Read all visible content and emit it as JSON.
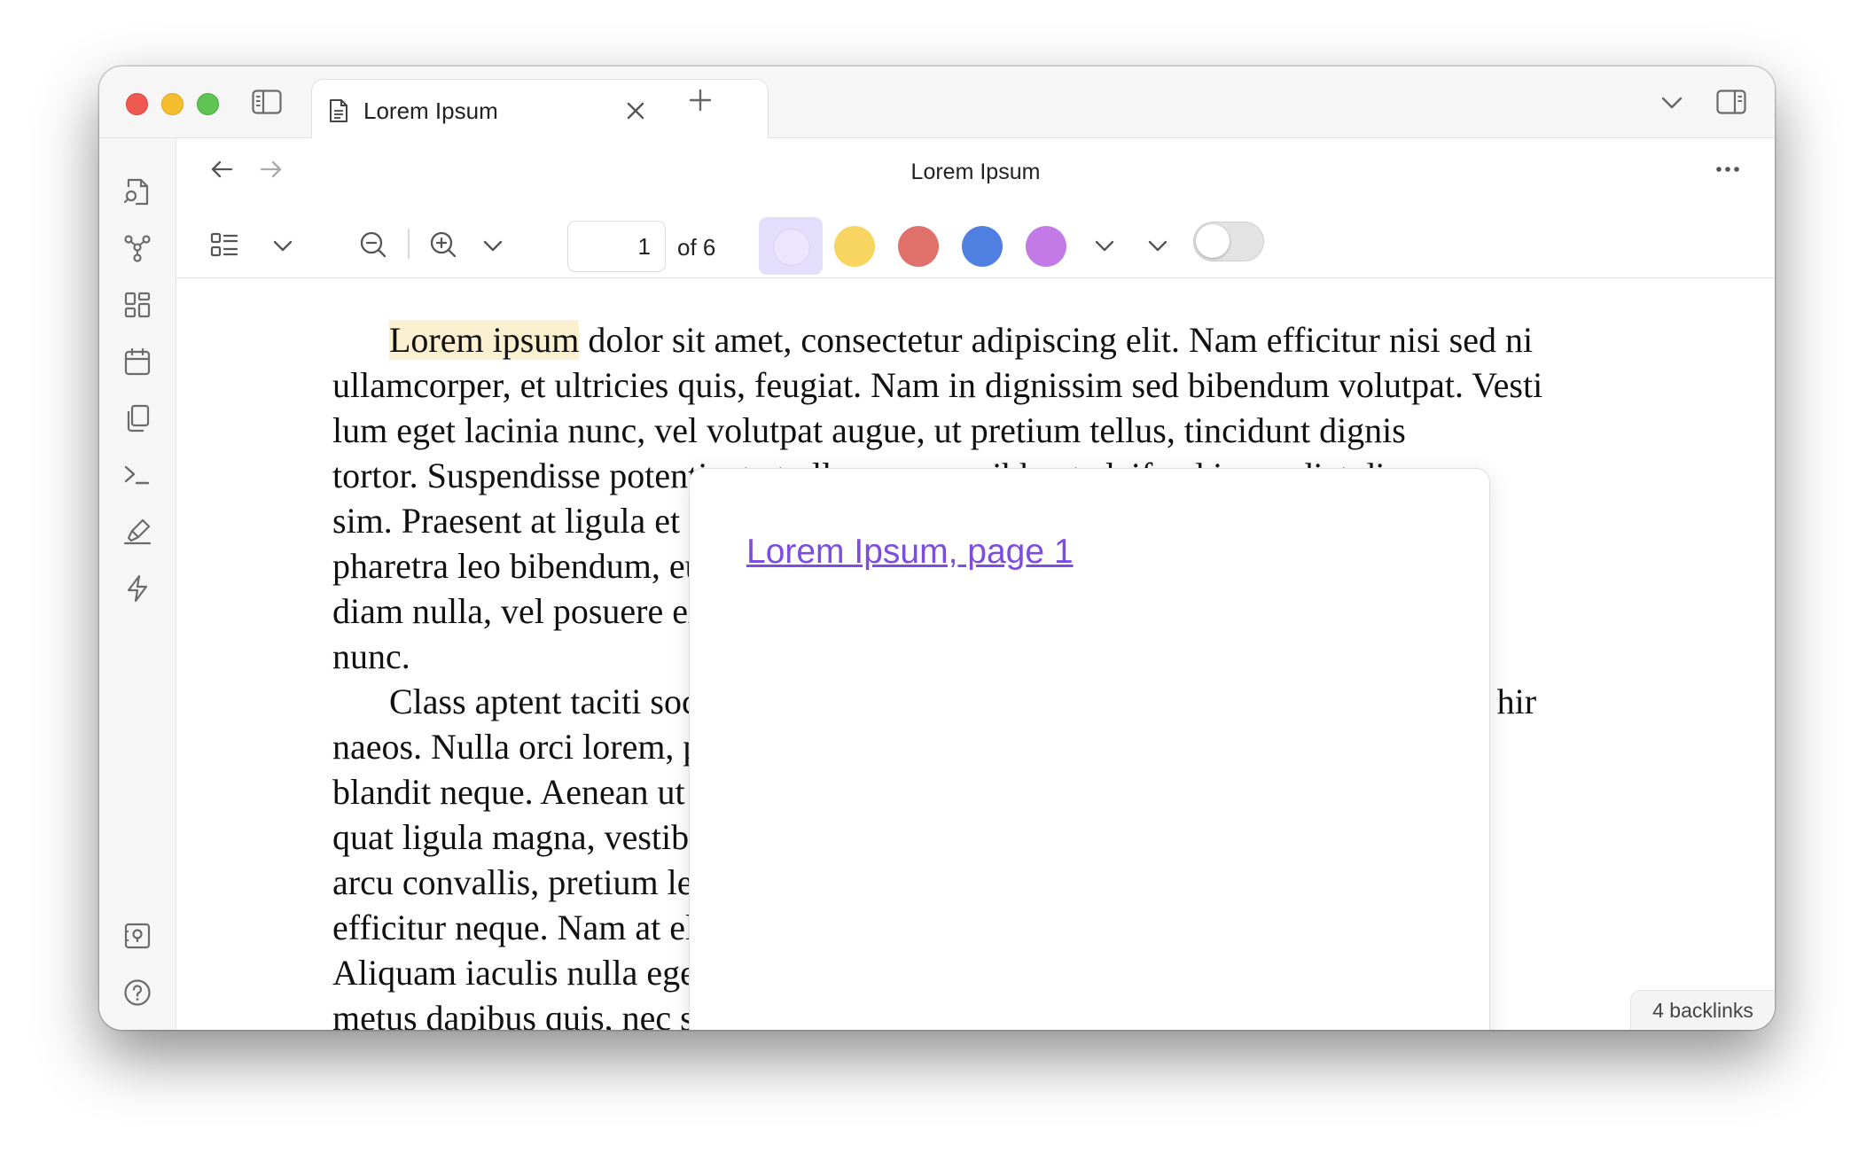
{
  "window": {
    "tab_title": "Lorem Ipsum",
    "icons": {
      "sidebar_toggle": "sidebar-left-icon",
      "tab_file": "file-icon",
      "tab_close": "close-icon",
      "new_tab": "plus-icon",
      "tab_list": "chevron-down-icon",
      "right_sidebar_toggle": "sidebar-right-icon"
    }
  },
  "ribbon": {
    "top_icons": [
      "file-search-icon",
      "graph-icon",
      "grid-icon",
      "calendar-icon",
      "copy-icon",
      "terminal-icon",
      "highlighter-icon",
      "lightning-icon"
    ],
    "bottom_icons": [
      "vault-icon",
      "help-icon",
      "settings-icon"
    ]
  },
  "view": {
    "title": "Lorem Ipsum",
    "back": "arrow-left-icon",
    "forward": "arrow-right-icon",
    "more": "more-horizontal-icon"
  },
  "toolbar": {
    "page_value": "1",
    "page_of": "of 6",
    "highlight_colors": [
      "#ebe6fd",
      "#f8d460",
      "#e0706a",
      "#4f80e1",
      "#c47ae6"
    ],
    "toggle_on": false
  },
  "document": {
    "highlight": "Lorem ipsum",
    "lines": [
      " dolor sit amet, consectetur adipiscing elit.  Nam efficitur nisi sed ni",
      "ullamcorper, et ultricies quis, feugiat. Nam in dignissim sed bibendum volutpat.  Vesti",
      "lum eget lacinia nunc, vel volutpat augue, ut pretium tellus, tincidunt dignis",
      "tortor. Suspendisse potenti, et et ullamcorper nibh, et eleifend imperdiet dign",
      "sim. Praesent at ligula et nunc tincidunt sodales. Maecenas ultrices neque odio",
      "pharetra leo bibendum, euismod nulla sed, porttitor ipsum semper. Donec ultri",
      "diam nulla, vel posuere ex. Suspendisse potenti. Donec eget consecte",
      "nunc.",
      "Class aptent taciti sociosqu ad litora torquent per conubia nostra, per inceptos hir",
      "naeos.  Nulla orci lorem, porta vitae purus in, posuere et nisl ac, volut",
      "blandit neque.  Aenean ut gravida arcu. Nulla quis arcu rhoncus leo, sed con",
      "quat ligula magna, vestibulum non sem quis, scelerisque.  Donec sceleris",
      "arcu convallis, pretium lectus at, tincidunt mauris.  Curabitur",
      "efficitur neque.  Nam at elementum mauris, malesuada sit amet do",
      "Aliquam iaculis nulla eget pulvinar rutrum, vitae dictum.  Curabitur sed ip",
      "metus dapibus quis, nec sagittis ipsum, a ultrices nisi. Integer ultrices arcu."
    ]
  },
  "popover": {
    "link": "Lorem Ipsum, page 1"
  },
  "status": {
    "backlinks": "4 backlinks"
  }
}
